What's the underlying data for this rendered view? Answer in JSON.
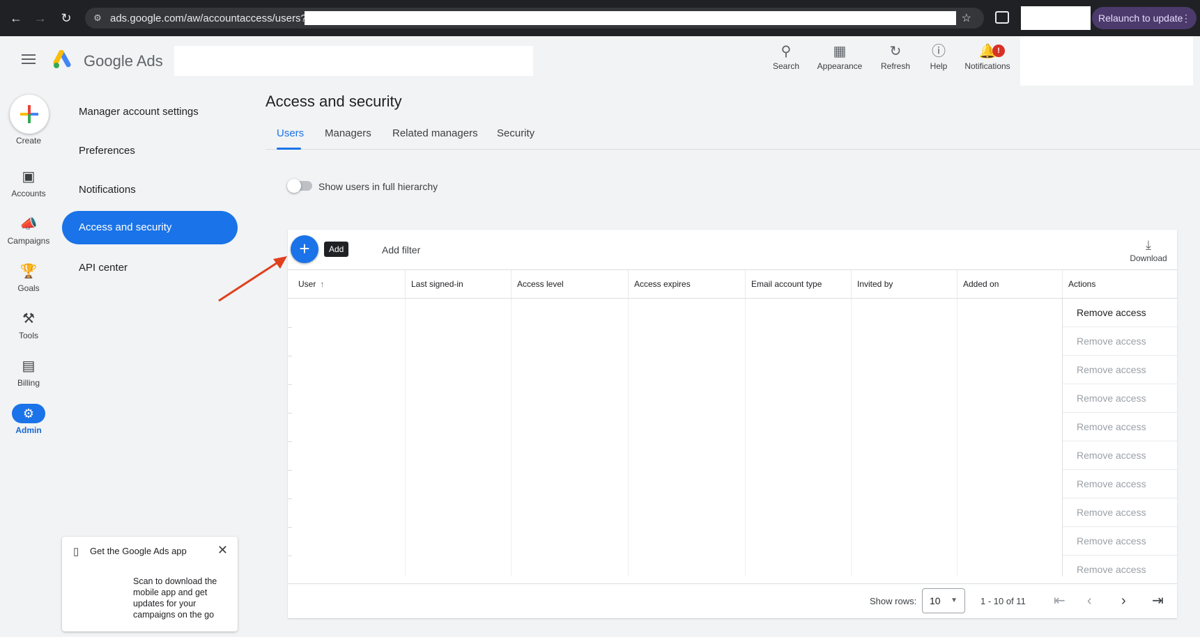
{
  "browser": {
    "url": "ads.google.com/aw/accountaccess/users?",
    "relaunch_label": "Relaunch to update",
    "back_icon": "arrow-left-icon",
    "forward_icon": "arrow-right-icon",
    "reload_icon": "reload-icon"
  },
  "appbar": {
    "brand": "Google Ads",
    "tools": [
      {
        "icon": "search-icon",
        "label": "Search"
      },
      {
        "icon": "appearance-icon",
        "label": "Appearance"
      },
      {
        "icon": "refresh-icon",
        "label": "Refresh"
      },
      {
        "icon": "help-icon",
        "label": "Help"
      },
      {
        "icon": "bell-icon",
        "label": "Notifications",
        "badge": "!"
      }
    ]
  },
  "rail": {
    "create_label": "Create",
    "items": [
      {
        "icon": "accounts-icon",
        "label": "Accounts"
      },
      {
        "icon": "campaigns-icon",
        "label": "Campaigns"
      },
      {
        "icon": "goals-icon",
        "label": "Goals"
      },
      {
        "icon": "tools-icon",
        "label": "Tools"
      },
      {
        "icon": "billing-icon",
        "label": "Billing"
      },
      {
        "icon": "gear-icon",
        "label": "Admin",
        "active": true
      }
    ]
  },
  "sidebar": {
    "items": [
      {
        "label": "Manager account settings"
      },
      {
        "label": "Preferences"
      },
      {
        "label": "Notifications"
      },
      {
        "label": "Access and security",
        "active": true
      },
      {
        "label": "API center"
      }
    ]
  },
  "main": {
    "title": "Access and security",
    "tabs": [
      {
        "label": "Users",
        "active": true
      },
      {
        "label": "Managers"
      },
      {
        "label": "Related managers"
      },
      {
        "label": "Security"
      }
    ],
    "toggle_label": "Show users in full hierarchy",
    "toggle_on": false
  },
  "table": {
    "add_tooltip": "Add",
    "add_filter": "Add filter",
    "download_label": "Download",
    "columns": [
      "User",
      "Last signed-in",
      "Access level",
      "Access expires",
      "Email account type",
      "Invited by",
      "Added on",
      "Actions"
    ],
    "rows": [
      {
        "action": "Remove access",
        "enabled": true
      },
      {
        "action": "Remove access",
        "enabled": false
      },
      {
        "action": "Remove access",
        "enabled": false
      },
      {
        "action": "Remove access",
        "enabled": false
      },
      {
        "action": "Remove access",
        "enabled": false
      },
      {
        "action": "Remove access",
        "enabled": false
      },
      {
        "action": "Remove access",
        "enabled": false
      },
      {
        "action": "Remove access",
        "enabled": false
      },
      {
        "action": "Remove access",
        "enabled": false
      },
      {
        "action": "Remove access",
        "enabled": false
      }
    ],
    "footer": {
      "show_rows_label": "Show rows:",
      "rows_value": "10",
      "range": "1 - 10 of 11"
    }
  },
  "promo": {
    "title": "Get the Google Ads app",
    "body": "Scan to download the mobile app and get updates for your campaigns on the go"
  },
  "colors": {
    "accent": "#1a73e8",
    "annotation_arrow": "#e0401e",
    "badge": "#d93025"
  }
}
